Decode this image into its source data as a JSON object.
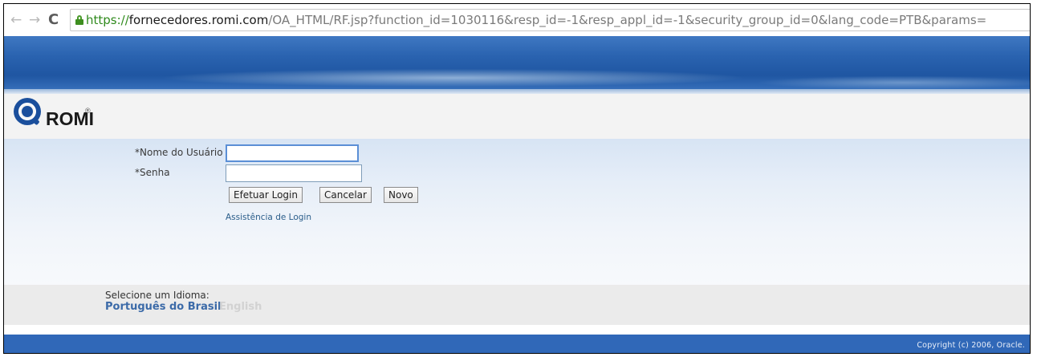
{
  "browser": {
    "back_icon": "←",
    "forward_icon": "→",
    "reload_icon": "C",
    "url_scheme": "https://",
    "url_host": "fornecedores.romi.com",
    "url_path": "/OA_HTML/RF.jsp?function_id=1030116&resp_id=-1&resp_appl_id=-1&security_group_id=0&lang_code=PTB&params=",
    "accent_https": "#2f8a1c"
  },
  "logo": {
    "text": "ROMI",
    "registered_mark": "®",
    "brand_color": "#1b4f9c"
  },
  "login_form": {
    "username_label": "*Nome do Usuário",
    "username_value": "",
    "password_label": "*Senha",
    "password_value": "",
    "login_button": "Efetuar Login",
    "cancel_button": "Cancelar",
    "new_button": "Novo",
    "help_link": "Assistência de Login"
  },
  "language": {
    "label": "Selecione um Idioma:",
    "current": "Português do Brasil",
    "other": "English"
  },
  "footer": {
    "copyright": "Copyright (c) 2006, Oracle.",
    "bar_color": "#3068b8"
  }
}
